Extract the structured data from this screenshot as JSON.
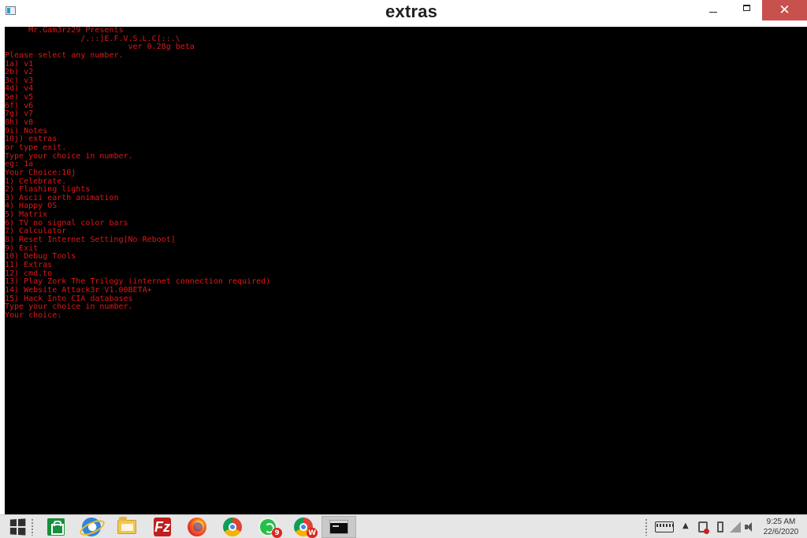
{
  "window": {
    "title": "extras",
    "close_glyph": "✕"
  },
  "console": {
    "lines": [
      "     Mr.Gam3rz29 Presents",
      "                /.::]E.F.V.S.L.C[::.\\",
      "                          ver 0.28g beta",
      "Please select any number.",
      "1a) v1",
      "2b) v2",
      "3c) v3",
      "4d) v4",
      "5e) v5",
      "6f) v6",
      "7g) v7",
      "8h) v8",
      "9i) Notes",
      "10j) extras",
      "or type exit.",
      "Type your choice in number.",
      "eg: 1a",
      "Your Choice:10j",
      "1) Celebrate.",
      "2) Flashing lights",
      "3) Ascii earth animation",
      "4) Happy OS",
      "5) Matrix",
      "6) TV no signal color bars",
      "7) Calculator",
      "8) Reset Internet Setting[No Reboot]",
      "9) Exit",
      "10) Debug Tools",
      "11) Extras",
      "12) cmd.to",
      "13) Play Zork The Trilogy (internet connection required)",
      "14) Website Attack3r V1.00BETA+",
      "15) Hack Into CIA databases",
      "Type your choice in number.",
      "Your choice:"
    ],
    "text_color": "#e01717",
    "background_color": "#000000"
  },
  "taskbar": {
    "items": [
      {
        "name": "start-button",
        "icon": "windows-logo-icon"
      },
      {
        "name": "store",
        "icon": "store-icon"
      },
      {
        "name": "internet-explorer",
        "icon": "ie-icon"
      },
      {
        "name": "file-explorer",
        "icon": "folder-icon"
      },
      {
        "name": "filezilla",
        "icon": "filezilla-icon",
        "glyph": "Fz"
      },
      {
        "name": "firefox",
        "icon": "firefox-icon"
      },
      {
        "name": "chrome",
        "icon": "chrome-icon"
      },
      {
        "name": "whatsapp",
        "icon": "whatsapp-icon",
        "badge": "9"
      },
      {
        "name": "chrome-profile",
        "icon": "chrome-icon",
        "badge": "W"
      },
      {
        "name": "command-prompt",
        "icon": "cmd-icon",
        "active": true
      }
    ],
    "tray": {
      "chevron": "▲",
      "time": "9:25 AM",
      "date": "22/6/2020"
    }
  }
}
